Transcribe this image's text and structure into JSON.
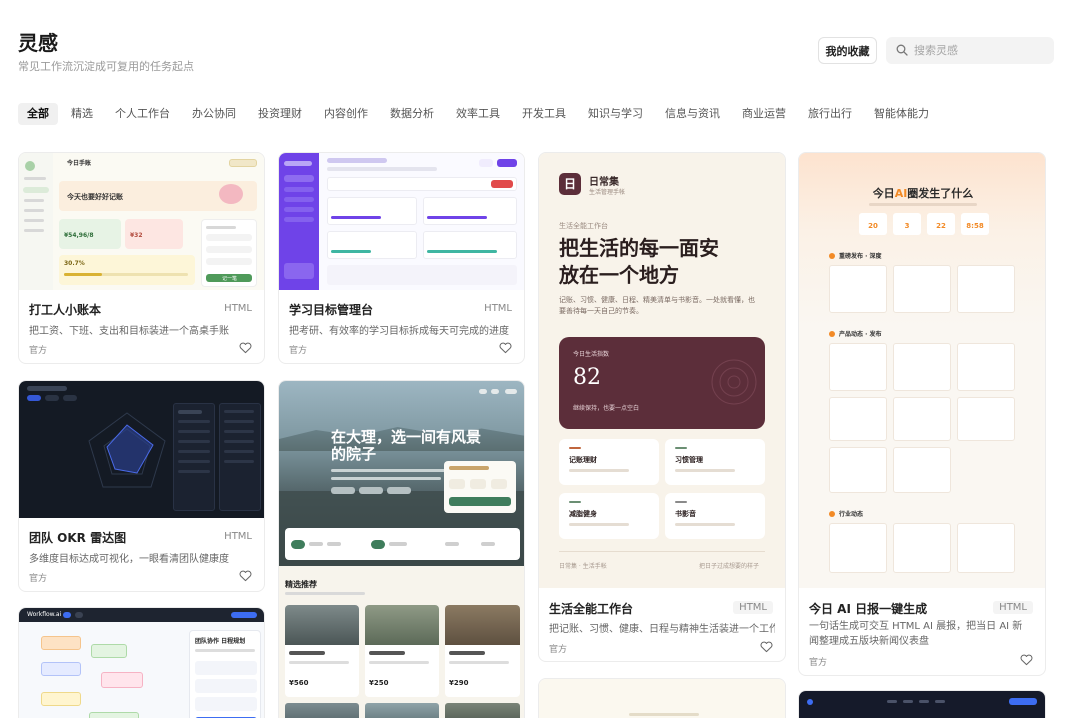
{
  "header": {
    "title": "灵感",
    "subtitle": "常见工作流沉淀成可复用的任务起点",
    "favorites_label": "我的收藏",
    "search_placeholder": "搜索灵感",
    "search_icon": "search-icon"
  },
  "tabs": [
    {
      "label": "全部",
      "active": true
    },
    {
      "label": "精选"
    },
    {
      "label": "个人工作台"
    },
    {
      "label": "办公协同"
    },
    {
      "label": "投资理财"
    },
    {
      "label": "内容创作"
    },
    {
      "label": "数据分析"
    },
    {
      "label": "效率工具"
    },
    {
      "label": "开发工具"
    },
    {
      "label": "知识与学习"
    },
    {
      "label": "信息与资讯"
    },
    {
      "label": "商业运营"
    },
    {
      "label": "旅行出行"
    },
    {
      "label": "智能体能力"
    }
  ],
  "cards": {
    "ledger": {
      "title": "打工人小账本",
      "badge": "HTML",
      "desc": "把工资、下班、支出和目标装进一个高桌手账",
      "author": "官方",
      "thumb": {
        "header": "今日手账",
        "hero": "今天也要好好记账",
        "stat1": "¥54,96/8",
        "stat2": "¥32",
        "progress": "30.7%",
        "button": "记一笔"
      }
    },
    "study": {
      "title": "学习目标管理台",
      "badge": "HTML",
      "desc": "把考研、有效率的学习目标拆成每天可完成的进度",
      "author": "官方"
    },
    "okr": {
      "title": "团队 OKR 雷达图",
      "badge": "HTML",
      "desc": "多维度目标达成可视化，一眼看清团队健康度",
      "author": "官方"
    },
    "dali": {
      "hero_title": "在大理，选一间有风景的院子",
      "section": "精选推荐",
      "prices": [
        "¥560",
        "¥250",
        "¥290"
      ]
    },
    "life": {
      "title": "生活全能工作台",
      "badge": "HTML",
      "desc": "把记账、习惯、健康、日程与精神生活装进一个工作台",
      "author": "官方",
      "thumb": {
        "logo": "日",
        "app": "日常集",
        "app_sub": "生活管理手帐",
        "kicker": "生活全能工作台",
        "headline": "把生活的每一面安放在一个地方",
        "para": "记账、习惯、健康、日程、精美清单与书影音。一处就看懂，也要善待每一天自己的节奏。",
        "counter_label": "今日生活指数",
        "counter": "82",
        "counter_sub": "继续保持，也要一点空白",
        "tiles": [
          "记账理财",
          "习惯管理",
          "减脂健身",
          "书影音"
        ],
        "footer_left": "日常集 · 生活手帐",
        "footer_right": "把日子过成想要的样子"
      }
    },
    "ai_daily": {
      "title": "今日 AI 日报一键生成",
      "badge": "HTML",
      "desc": "一句话生成可交互 HTML AI 晨报，把当日 AI 新闻整理成五版块新闻仪表盘",
      "author": "官方",
      "thumb": {
        "headline_pre": "今日",
        "headline_ai": "AI",
        "headline_post": "圈发生了什么",
        "stats": [
          "20",
          "3",
          "22",
          "8:58"
        ],
        "sec1": "重磅发布 · 深度",
        "sec2": "产品动态 · 发布",
        "sec3": "行业动态"
      }
    },
    "workflow": {
      "topbar": "Workflow.ai",
      "panel_title": "团队协作 日程规划"
    }
  },
  "colors": {
    "accent_purple": "#6f43e8",
    "life_brown": "#5c2e3a",
    "ai_orange": "#f28a26",
    "dark_bg": "#141a24"
  }
}
